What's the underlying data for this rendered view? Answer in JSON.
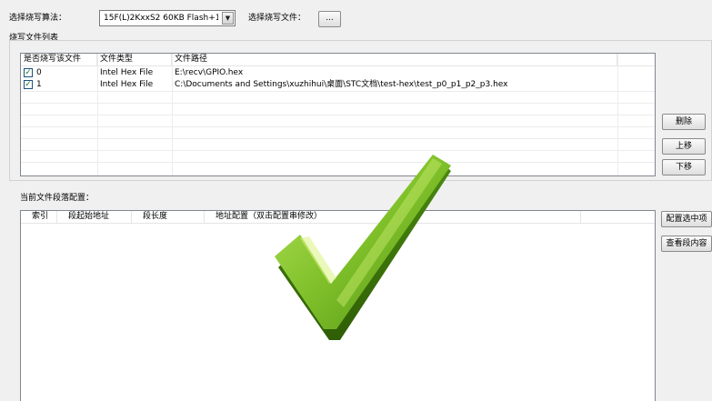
{
  "algorithm": {
    "label": "选择烧写算法：",
    "value": "15F(L)2KxxS2 60KB Flash+1!",
    "arrow": "▼"
  },
  "file_select": {
    "label": "选择烧写文件：",
    "button": "..."
  },
  "burn_list": {
    "title": "烧写文件列表",
    "columns": [
      "是否烧写该文件",
      "文件类型",
      "文件路径"
    ],
    "rows": [
      {
        "checked": true,
        "index": "0",
        "type": "Intel Hex File",
        "path": "E:\\recv\\GPIO.hex"
      },
      {
        "checked": true,
        "index": "1",
        "type": "Intel Hex File",
        "path": "C:\\Documents and Settings\\xuzhihui\\桌面\\STC文档\\test-hex\\test_p0_p1_p2_p3.hex"
      }
    ],
    "buttons": {
      "delete": "删除",
      "up": "上移",
      "down": "下移"
    }
  },
  "segment": {
    "title": "当前文件段落配置：",
    "columns": [
      "索引",
      "段起始地址",
      "段长度",
      "地址配置（双击配置串修改）"
    ],
    "buttons": {
      "config_selected": "配置选中项",
      "view_content": "查看段内容"
    }
  },
  "overlay": {
    "icon": "checkmark-icon",
    "color": "#6aaa1c"
  }
}
